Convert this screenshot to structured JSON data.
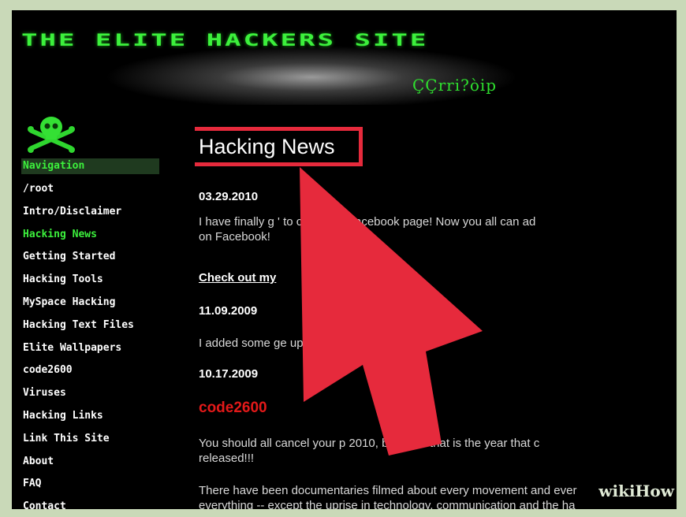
{
  "header": {
    "site_title": "THE ELITE HACKERS SITE",
    "site_subtitle": "ÇÇrri?òip"
  },
  "sidebar": {
    "nav_header": "Navigation",
    "items": [
      {
        "label": "/root"
      },
      {
        "label": "Intro/Disclaimer"
      },
      {
        "label": "Hacking News",
        "active": true
      },
      {
        "label": "Getting Started"
      },
      {
        "label": "Hacking Tools"
      },
      {
        "label": "MySpace Hacking"
      },
      {
        "label": "Hacking Text Files"
      },
      {
        "label": "Elite Wallpapers"
      },
      {
        "label": "code2600"
      },
      {
        "label": "Viruses"
      },
      {
        "label": "Hacking Links"
      },
      {
        "label": "Link This Site"
      },
      {
        "label": "About"
      },
      {
        "label": "FAQ"
      },
      {
        "label": "Contact"
      }
    ]
  },
  "content": {
    "title": "Hacking News",
    "entries": [
      {
        "date": "03.29.2010",
        "text_line1": "I have finally g         ' to creating a facebook page! Now you all can ad",
        "text_line2": "on Facebook!",
        "link": "Check out my"
      },
      {
        "date": "11.09.2009",
        "text_line1": "I added some                                     ge up the look of your hacker"
      },
      {
        "date": "10.17.2009",
        "link": "code2600",
        "text_line1": "You should all cancel your p              2010, because that is the year that c",
        "text_line2": "released!!!",
        "text_line3": "There have been documentaries filmed about every movement and ever",
        "text_line4": "everything -- except the uprise in technology, communication and the ha"
      }
    ]
  },
  "overlay": {
    "highlight_color": "#e62a3c",
    "arrow_color": "#e62a3c"
  },
  "watermark": {
    "text": "wikiHow"
  }
}
